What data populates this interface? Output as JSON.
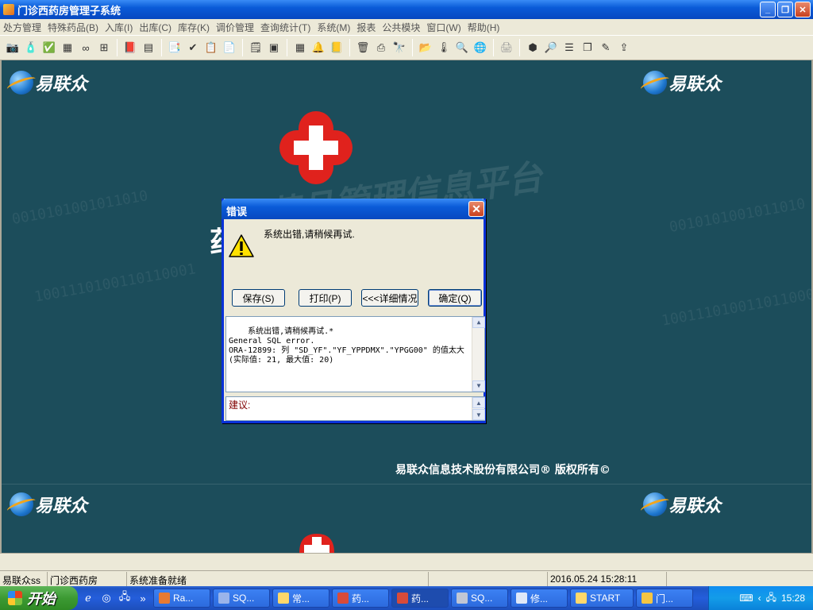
{
  "window": {
    "title": "门诊西药房管理子系统",
    "min_label": "_",
    "restore_label": "❐",
    "close_label": "✕"
  },
  "menu": [
    "处方管理",
    "特殊药品(B)",
    "入库(I)",
    "出库(C)",
    "库存(K)",
    "调价管理",
    "查询统计(T)",
    "系统(M)",
    "报表",
    "公共模块",
    "窗口(W)",
    "帮助(H)"
  ],
  "toolbar_icons": [
    [
      "camera-icon",
      "pill-bottle-icon",
      "check-shield-icon",
      "calculator-icon",
      "binoculars-icon",
      "gift-icon"
    ],
    [
      "book-icon",
      "card-icon"
    ],
    [
      "report-icon",
      "checkmark-icon",
      "clipboard-icon",
      "document-search-icon"
    ],
    [
      "form-icon",
      "window-list-icon"
    ],
    [
      "grid-icon",
      "bell-icon",
      "notepad-icon"
    ],
    [
      "trash-icon",
      "print-search-icon",
      "magnify-binoculars-icon"
    ],
    [
      "folder-icon",
      "thermometer-icon",
      "zoom-icon",
      "globe-window-icon"
    ],
    [
      "printer-icon"
    ],
    [
      "stamp-icon",
      "find-icon",
      "table-icon",
      "cascade-icon",
      "edit-doc-icon",
      "export-icon"
    ]
  ],
  "workspace": {
    "logo_text": "易联众",
    "copyright": "易联众信息技术股份有限公司® 版权所有©",
    "bg_binary_1": "0010101001011010",
    "bg_binary_2": "1001110100110110001",
    "bg_slogan": "药品管理信息平台",
    "partial_title": "药"
  },
  "dialog": {
    "title": "错误",
    "message": "系统出错,请稍候再试.",
    "buttons": {
      "save": "保存(S)",
      "print": "打印(P)",
      "details": "<<<详细情况",
      "ok": "确定(Q)"
    },
    "detail_text": "系统出错,请稍候再试.*\nGeneral SQL error.\nORA-12899: 列 \"SD_YF\".\"YF_YPPDMX\".\"YPGG00\" 的值太大 (实际值: 21, 最大值: 20)",
    "suggest_label": "建议:"
  },
  "statusbar": {
    "user": "易联众ss",
    "dept": "门诊西药房",
    "status": "系统准备就绪",
    "empty1": "",
    "datetime": "2016.05.24 15:28:11"
  },
  "taskbar": {
    "start_label": "开始",
    "more_label": "»",
    "items": [
      "Ra...",
      "SQ...",
      "常...",
      "药...",
      "药...",
      "SQ...",
      "修...",
      "START",
      "门..."
    ],
    "active_index": 4,
    "clock": "15:28"
  }
}
